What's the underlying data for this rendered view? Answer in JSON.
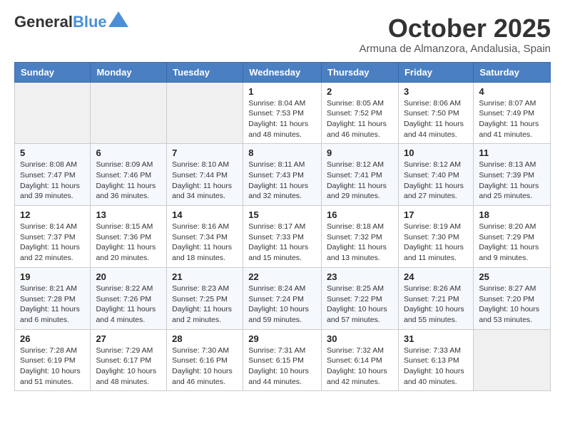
{
  "logo": {
    "general": "General",
    "blue": "Blue"
  },
  "title": "October 2025",
  "location": "Armuna de Almanzora, Andalusia, Spain",
  "headers": [
    "Sunday",
    "Monday",
    "Tuesday",
    "Wednesday",
    "Thursday",
    "Friday",
    "Saturday"
  ],
  "weeks": [
    [
      {
        "day": "",
        "info": ""
      },
      {
        "day": "",
        "info": ""
      },
      {
        "day": "",
        "info": ""
      },
      {
        "day": "1",
        "info": "Sunrise: 8:04 AM\nSunset: 7:53 PM\nDaylight: 11 hours and 48 minutes."
      },
      {
        "day": "2",
        "info": "Sunrise: 8:05 AM\nSunset: 7:52 PM\nDaylight: 11 hours and 46 minutes."
      },
      {
        "day": "3",
        "info": "Sunrise: 8:06 AM\nSunset: 7:50 PM\nDaylight: 11 hours and 44 minutes."
      },
      {
        "day": "4",
        "info": "Sunrise: 8:07 AM\nSunset: 7:49 PM\nDaylight: 11 hours and 41 minutes."
      }
    ],
    [
      {
        "day": "5",
        "info": "Sunrise: 8:08 AM\nSunset: 7:47 PM\nDaylight: 11 hours and 39 minutes."
      },
      {
        "day": "6",
        "info": "Sunrise: 8:09 AM\nSunset: 7:46 PM\nDaylight: 11 hours and 36 minutes."
      },
      {
        "day": "7",
        "info": "Sunrise: 8:10 AM\nSunset: 7:44 PM\nDaylight: 11 hours and 34 minutes."
      },
      {
        "day": "8",
        "info": "Sunrise: 8:11 AM\nSunset: 7:43 PM\nDaylight: 11 hours and 32 minutes."
      },
      {
        "day": "9",
        "info": "Sunrise: 8:12 AM\nSunset: 7:41 PM\nDaylight: 11 hours and 29 minutes."
      },
      {
        "day": "10",
        "info": "Sunrise: 8:12 AM\nSunset: 7:40 PM\nDaylight: 11 hours and 27 minutes."
      },
      {
        "day": "11",
        "info": "Sunrise: 8:13 AM\nSunset: 7:39 PM\nDaylight: 11 hours and 25 minutes."
      }
    ],
    [
      {
        "day": "12",
        "info": "Sunrise: 8:14 AM\nSunset: 7:37 PM\nDaylight: 11 hours and 22 minutes."
      },
      {
        "day": "13",
        "info": "Sunrise: 8:15 AM\nSunset: 7:36 PM\nDaylight: 11 hours and 20 minutes."
      },
      {
        "day": "14",
        "info": "Sunrise: 8:16 AM\nSunset: 7:34 PM\nDaylight: 11 hours and 18 minutes."
      },
      {
        "day": "15",
        "info": "Sunrise: 8:17 AM\nSunset: 7:33 PM\nDaylight: 11 hours and 15 minutes."
      },
      {
        "day": "16",
        "info": "Sunrise: 8:18 AM\nSunset: 7:32 PM\nDaylight: 11 hours and 13 minutes."
      },
      {
        "day": "17",
        "info": "Sunrise: 8:19 AM\nSunset: 7:30 PM\nDaylight: 11 hours and 11 minutes."
      },
      {
        "day": "18",
        "info": "Sunrise: 8:20 AM\nSunset: 7:29 PM\nDaylight: 11 hours and 9 minutes."
      }
    ],
    [
      {
        "day": "19",
        "info": "Sunrise: 8:21 AM\nSunset: 7:28 PM\nDaylight: 11 hours and 6 minutes."
      },
      {
        "day": "20",
        "info": "Sunrise: 8:22 AM\nSunset: 7:26 PM\nDaylight: 11 hours and 4 minutes."
      },
      {
        "day": "21",
        "info": "Sunrise: 8:23 AM\nSunset: 7:25 PM\nDaylight: 11 hours and 2 minutes."
      },
      {
        "day": "22",
        "info": "Sunrise: 8:24 AM\nSunset: 7:24 PM\nDaylight: 10 hours and 59 minutes."
      },
      {
        "day": "23",
        "info": "Sunrise: 8:25 AM\nSunset: 7:22 PM\nDaylight: 10 hours and 57 minutes."
      },
      {
        "day": "24",
        "info": "Sunrise: 8:26 AM\nSunset: 7:21 PM\nDaylight: 10 hours and 55 minutes."
      },
      {
        "day": "25",
        "info": "Sunrise: 8:27 AM\nSunset: 7:20 PM\nDaylight: 10 hours and 53 minutes."
      }
    ],
    [
      {
        "day": "26",
        "info": "Sunrise: 7:28 AM\nSunset: 6:19 PM\nDaylight: 10 hours and 51 minutes."
      },
      {
        "day": "27",
        "info": "Sunrise: 7:29 AM\nSunset: 6:17 PM\nDaylight: 10 hours and 48 minutes."
      },
      {
        "day": "28",
        "info": "Sunrise: 7:30 AM\nSunset: 6:16 PM\nDaylight: 10 hours and 46 minutes."
      },
      {
        "day": "29",
        "info": "Sunrise: 7:31 AM\nSunset: 6:15 PM\nDaylight: 10 hours and 44 minutes."
      },
      {
        "day": "30",
        "info": "Sunrise: 7:32 AM\nSunset: 6:14 PM\nDaylight: 10 hours and 42 minutes."
      },
      {
        "day": "31",
        "info": "Sunrise: 7:33 AM\nSunset: 6:13 PM\nDaylight: 10 hours and 40 minutes."
      },
      {
        "day": "",
        "info": ""
      }
    ]
  ]
}
